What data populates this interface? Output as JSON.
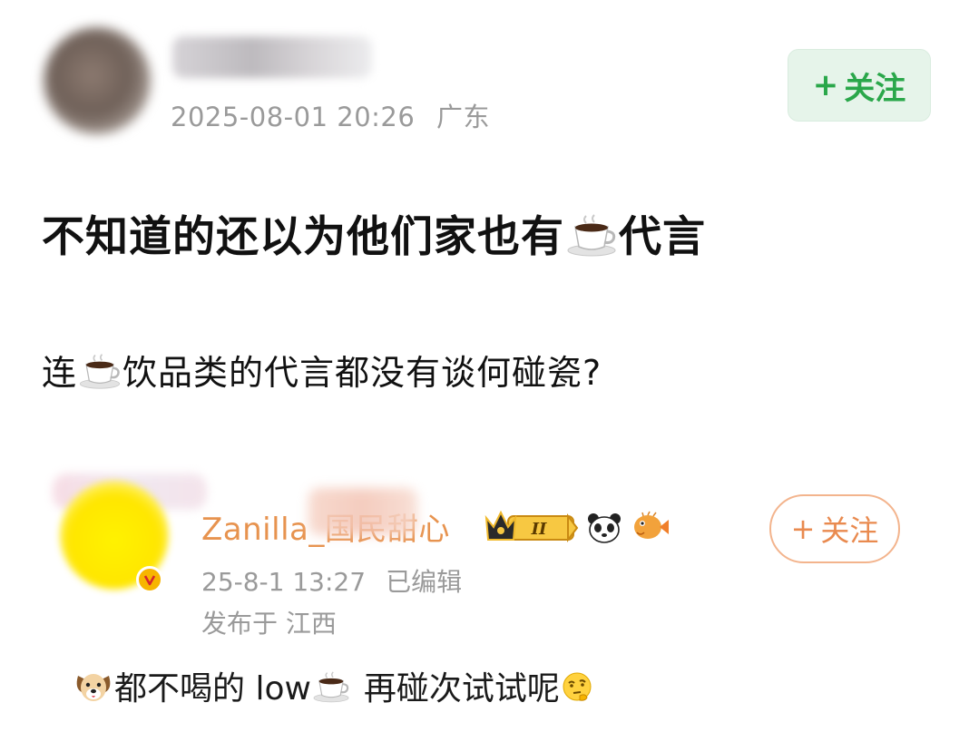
{
  "post": {
    "timestamp": "2025-08-01 20:26",
    "location": "广东",
    "follow_label": "关注",
    "line1_before": "不知道的还以为他们家也有",
    "line1_after": "代言",
    "line2_before": "连",
    "line2_after": "饮品类的代言都没有谈何碰瓷?"
  },
  "comment": {
    "username": "Zanilla_国民甜心",
    "level_badge": "II",
    "time": "25-8-1 13:27",
    "edited": "已编辑",
    "location_line": "发布于 江西",
    "follow_label": "关注",
    "text_before": "都不喝的 low",
    "text_after": "再碰次试试呢"
  },
  "icons": [
    "coffee-icon",
    "crown-badge-icon",
    "panda-icon",
    "pufferfish-icon",
    "dog-icon",
    "thinking-face-icon",
    "verified-v-icon",
    "plus-icon"
  ],
  "colors": {
    "follow_green": "#2aa74a",
    "follow_green_bg": "#e6f4ea",
    "username_orange": "#e7934f",
    "follow_orange": "#e98a4f",
    "meta_gray": "#9a9a9a"
  }
}
